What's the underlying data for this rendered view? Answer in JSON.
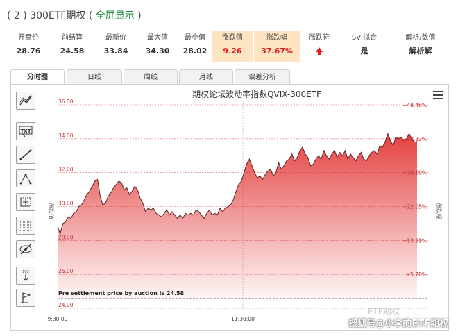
{
  "header": {
    "title_prefix": "( 2 ) 300ETF期权 (",
    "title_link": "全屏显示",
    "title_suffix": ")"
  },
  "quote": {
    "columns": [
      {
        "label": "开盘价",
        "value": "28.76"
      },
      {
        "label": "前结算",
        "value": "24.58"
      },
      {
        "label": "最新价",
        "value": "33.84"
      },
      {
        "label": "最大值",
        "value": "34.30"
      },
      {
        "label": "最小值",
        "value": "28.02"
      },
      {
        "label": "涨跌值",
        "value": "9.26"
      },
      {
        "label": "涨跌幅",
        "value": "37.67%"
      },
      {
        "label": "涨跌符",
        "value": ""
      },
      {
        "label": "SVI拟合",
        "value": "是"
      },
      {
        "label": "解析/数值",
        "value": "解析解"
      }
    ],
    "highlight_color": "#fde4c2",
    "up_color": "#e01c1c"
  },
  "tabs": [
    {
      "label": "分时图",
      "active": true
    },
    {
      "label": "日线",
      "active": false
    },
    {
      "label": "周线",
      "active": false
    },
    {
      "label": "月线",
      "active": false
    },
    {
      "label": "误差分析",
      "active": false
    }
  ],
  "toolbar": {
    "tools": [
      "trend-line-icon",
      "text-label-icon",
      "line-icon",
      "polyline-icon",
      "rectangle-icon",
      "fibonacci-icon",
      "hide-icon",
      "measure-icon",
      "flag-icon"
    ],
    "text_tool_label": "TXT",
    "measure_label": "103"
  },
  "watermarks": {
    "faint": "ETF期权",
    "main": "搜狐号@小李的ETF期权"
  },
  "chart_data": {
    "type": "area",
    "title": "期权论坛波动率指数QVIX-300ETF",
    "ylabel_left": "涨跌值",
    "ylabel_right": "涨跌幅",
    "left_ticks": [
      "36.00",
      "34.00",
      "32.00",
      "30.00",
      "28.00",
      "26.00",
      "24.00"
    ],
    "right_ticks": [
      "+48.46%",
      "+38.32%",
      "+30.19%",
      "+22.05%",
      "+13.91%",
      "+5.78%"
    ],
    "x_ticks": [
      "9:30:00",
      "11:30:00"
    ],
    "ylim": [
      24.0,
      36.0
    ],
    "baseline": 24.58,
    "annotation": "Pre settlement price by auction is 24.58",
    "color": "#e02020",
    "values": [
      28.8,
      28.4,
      29.0,
      29.1,
      29.4,
      29.3,
      29.6,
      29.7,
      30.0,
      30.1,
      30.4,
      30.7,
      30.9,
      31.2,
      31.5,
      31.6,
      30.6,
      30.1,
      30.2,
      30.6,
      30.8,
      31.1,
      31.3,
      31.5,
      31.4,
      31.0,
      31.1,
      30.7,
      30.9,
      31.2,
      31.0,
      30.5,
      30.2,
      29.7,
      29.9,
      29.8,
      29.9,
      29.6,
      29.5,
      29.4,
      29.6,
      29.8,
      29.5,
      29.7,
      29.5,
      29.3,
      29.5,
      29.3,
      29.6,
      29.5,
      29.6,
      29.5,
      29.8,
      29.7,
      29.5,
      29.3,
      29.6,
      29.8,
      29.5,
      29.6,
      29.5,
      29.9,
      29.7,
      29.9,
      30.0,
      30.1,
      30.4,
      30.9,
      31.3,
      31.5,
      32.0,
      32.5,
      32.8,
      32.4,
      32.0,
      31.7,
      31.8,
      31.6,
      31.9,
      32.1,
      32.2,
      31.8,
      32.0,
      32.6,
      32.2,
      32.4,
      32.7,
      32.8,
      33.1,
      32.7,
      32.9,
      33.3,
      33.5,
      33.1,
      32.9,
      32.4,
      32.5,
      32.8,
      33.0,
      32.8,
      33.3,
      33.0,
      32.8,
      33.1,
      33.3,
      32.9,
      33.2,
      33.0,
      33.3,
      32.8,
      33.1,
      32.9,
      32.7,
      33.0,
      33.2,
      32.8,
      32.7,
      33.0,
      33.2,
      33.3,
      33.1,
      33.6,
      33.5,
      33.8,
      34.3,
      33.9,
      33.6,
      34.1,
      34.0,
      34.1,
      33.9,
      34.0,
      34.3,
      34.0,
      33.8,
      33.84
    ]
  }
}
